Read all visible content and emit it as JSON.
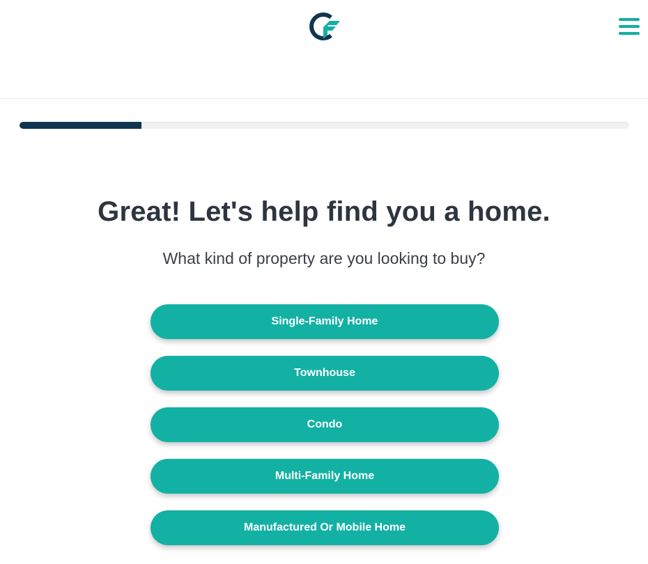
{
  "brand": {
    "logo_icon": "cf-logo-icon",
    "primary_color": "#12b1a4",
    "dark_color": "#0f3551"
  },
  "header": {
    "menu_icon": "hamburger-menu-icon"
  },
  "progress": {
    "fraction": 0.2
  },
  "main": {
    "heading": "Great! Let's help find you a home.",
    "question": "What kind of property are you looking to buy?",
    "options": [
      {
        "label": "Single-Family Home"
      },
      {
        "label": "Townhouse"
      },
      {
        "label": "Condo"
      },
      {
        "label": "Multi-Family Home"
      },
      {
        "label": "Manufactured Or Mobile Home"
      }
    ]
  }
}
